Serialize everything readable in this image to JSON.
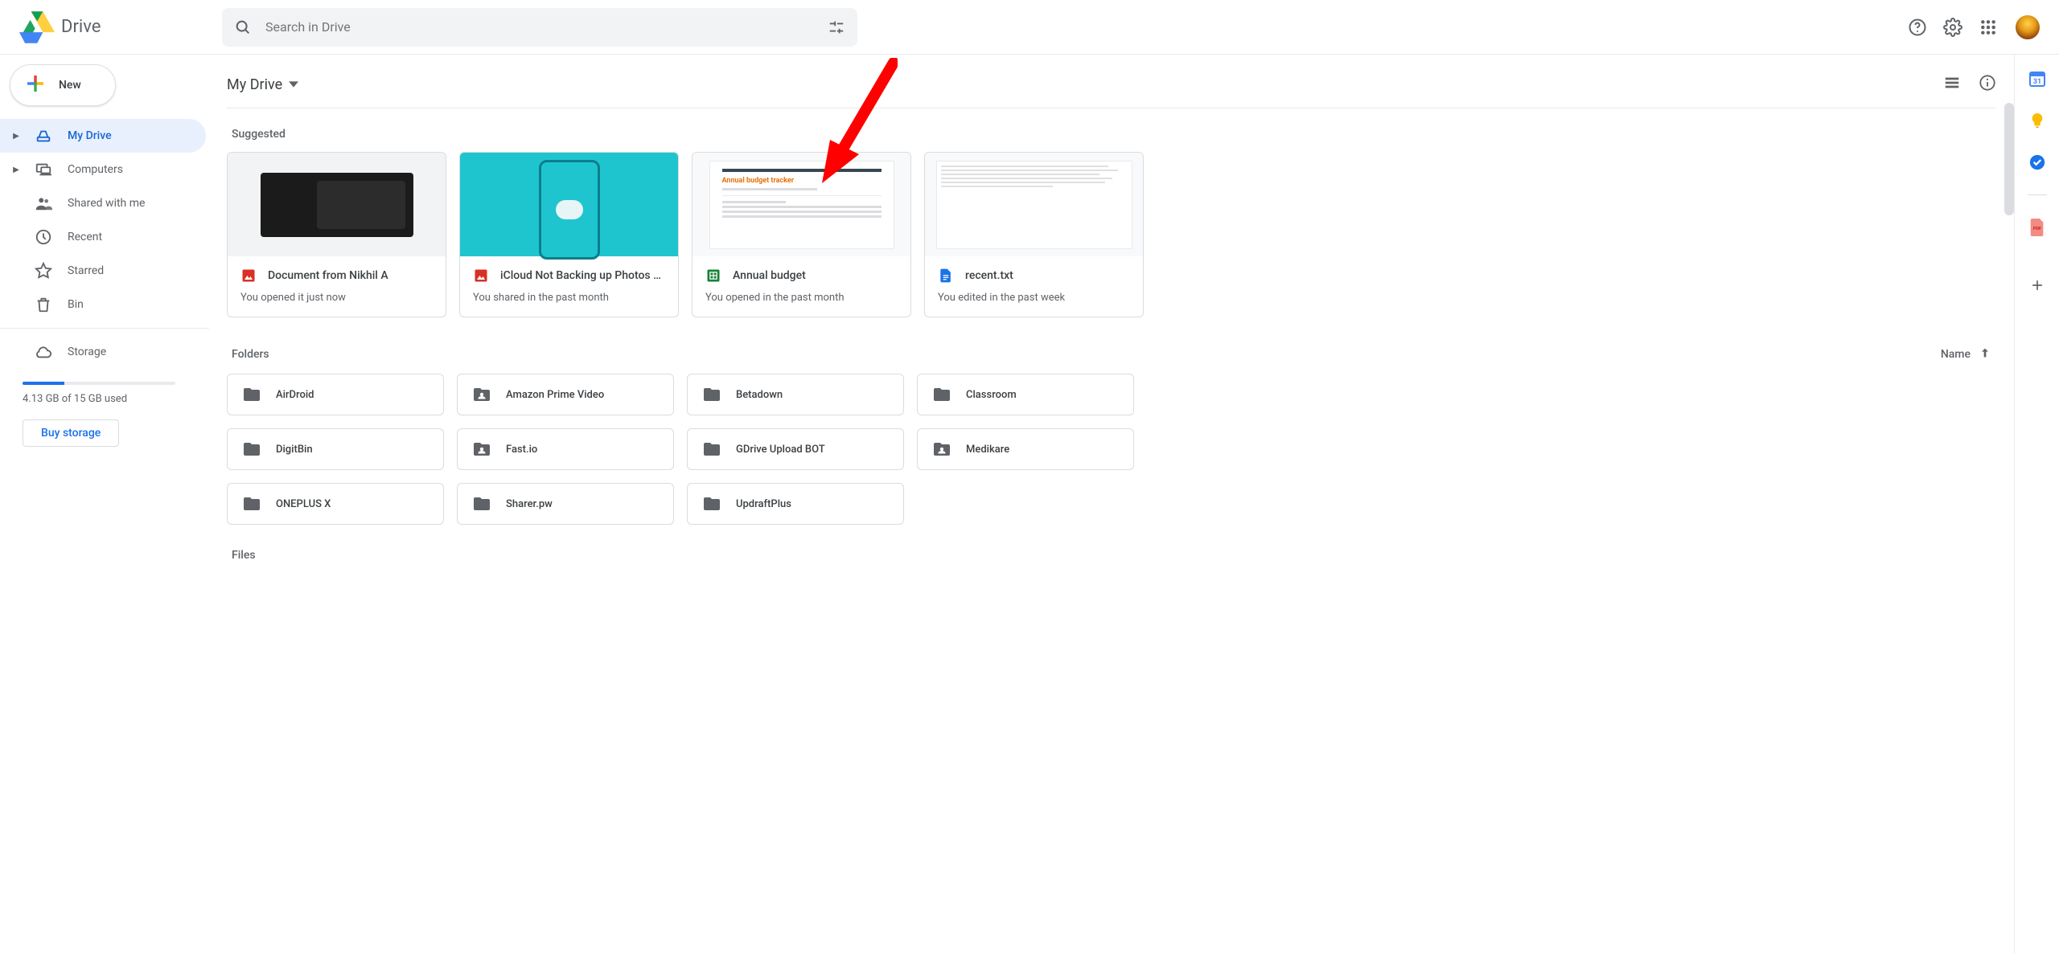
{
  "app": {
    "name": "Drive"
  },
  "search": {
    "placeholder": "Search in Drive"
  },
  "new_button": "New",
  "nav": {
    "my_drive": "My Drive",
    "computers": "Computers",
    "shared": "Shared with me",
    "recent": "Recent",
    "starred": "Starred",
    "bin": "Bin",
    "storage": "Storage"
  },
  "storage": {
    "used_text": "4.13 GB of 15 GB used",
    "buy": "Buy storage"
  },
  "breadcrumb": "My Drive",
  "sections": {
    "suggested": "Suggested",
    "folders": "Folders",
    "files": "Files",
    "sort": "Name"
  },
  "suggested": [
    {
      "title": "Document from Nikhil A",
      "sub": "You opened it just now",
      "type": "image"
    },
    {
      "title": "iCloud Not Backing up Photos …",
      "sub": "You shared in the past month",
      "type": "image"
    },
    {
      "title": "Annual budget",
      "sub": "You opened in the past month",
      "type": "sheets"
    },
    {
      "title": "recent.txt",
      "sub": "You edited in the past week",
      "type": "docs"
    }
  ],
  "folders": [
    {
      "name": "AirDroid",
      "shared": false
    },
    {
      "name": "Amazon Prime Video",
      "shared": true
    },
    {
      "name": "Betadown",
      "shared": false
    },
    {
      "name": "Classroom",
      "shared": false
    },
    {
      "name": "DigitBin",
      "shared": false
    },
    {
      "name": "Fast.io",
      "shared": true
    },
    {
      "name": "GDrive Upload BOT",
      "shared": false
    },
    {
      "name": "Medikare",
      "shared": true
    },
    {
      "name": "ONEPLUS X",
      "shared": false
    },
    {
      "name": "Sharer.pw",
      "shared": false
    },
    {
      "name": "UpdraftPlus",
      "shared": false
    }
  ],
  "thumb_budget_title": "Annual budget tracker",
  "side_panel": {
    "calendar_day": "31"
  }
}
